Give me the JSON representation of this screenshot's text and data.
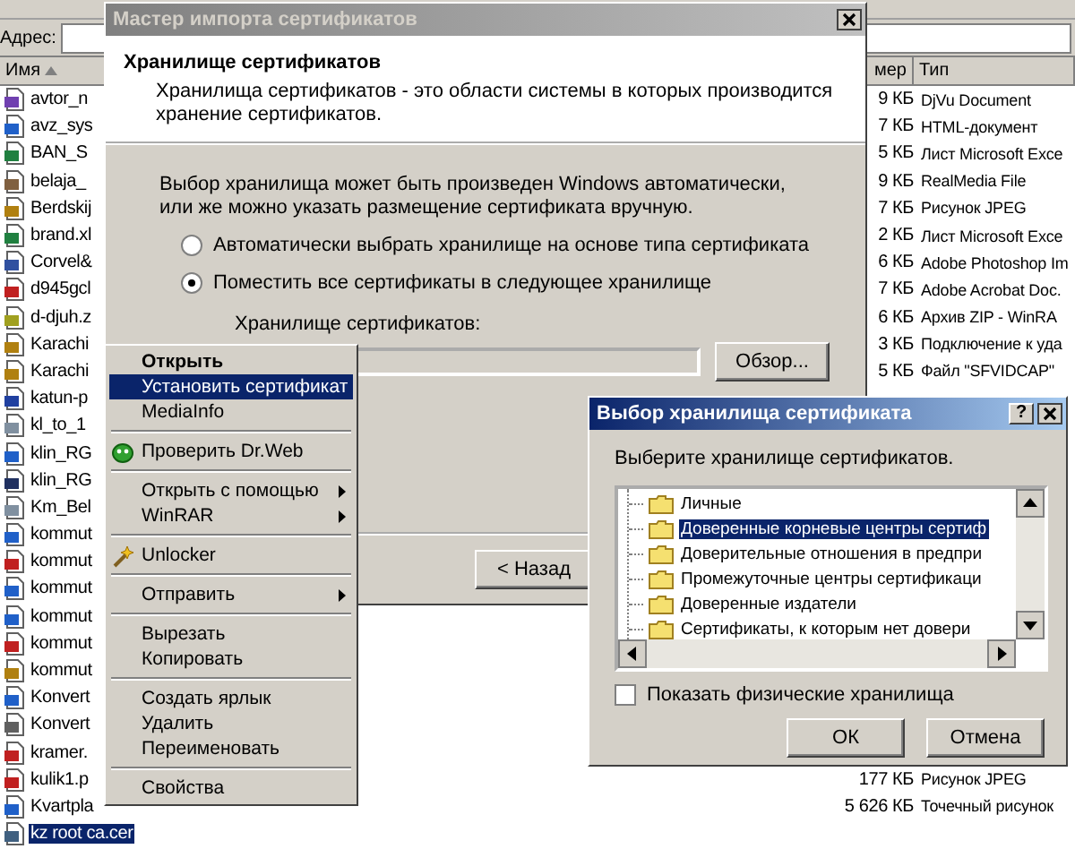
{
  "explorer": {
    "address_label": "Адрес:",
    "columns": [
      {
        "label": "Имя",
        "sorted": true
      },
      {
        "label": "мер",
        "sorted": false
      },
      {
        "label": "Тип",
        "sorted": false
      }
    ],
    "files": [
      {
        "name": "avtor_n",
        "kind": "djvu",
        "size": "9 КБ",
        "type": "DjVu Document",
        "selected": false
      },
      {
        "name": "avz_sys",
        "kind": "web",
        "size": "7 КБ",
        "type": "HTML-документ",
        "selected": false
      },
      {
        "name": "BAN_S",
        "kind": "excel",
        "size": "5 КБ",
        "type": "Лист Microsoft Exce",
        "selected": false
      },
      {
        "name": "belaja_",
        "kind": "media",
        "size": "9 КБ",
        "type": "RealMedia File",
        "selected": false
      },
      {
        "name": "Berdskij",
        "kind": "image",
        "size": "7 КБ",
        "type": "Рисунок JPEG",
        "selected": false
      },
      {
        "name": "brand.xl",
        "kind": "excel",
        "size": "2 КБ",
        "type": "Лист Microsoft Exce",
        "selected": false
      },
      {
        "name": "Corvel&",
        "kind": "psd",
        "size": "6 КБ",
        "type": "Adobe Photoshop Im",
        "selected": false
      },
      {
        "name": "d945gcl",
        "kind": "pdf",
        "size": "7 КБ",
        "type": "Adobe Acrobat Doc.",
        "selected": false
      },
      {
        "name": "d-djuh.z",
        "kind": "zip",
        "size": "6 КБ",
        "type": "Архив ZIP - WinRA",
        "selected": false
      },
      {
        "name": "Karachi",
        "kind": "image",
        "size": "3 КБ",
        "type": "Подключение к уда",
        "selected": false
      },
      {
        "name": "Karachi",
        "kind": "image",
        "size": "5 КБ",
        "type": "Файл \"SFVIDCAP\"",
        "selected": false
      },
      {
        "name": "katun-p",
        "kind": "bmp",
        "selected": false
      },
      {
        "name": "kl_to_1",
        "kind": "doc",
        "selected": false
      },
      {
        "name": "klin_RG",
        "kind": "web",
        "selected": false
      },
      {
        "name": "klin_RG",
        "kind": "tif",
        "selected": false
      },
      {
        "name": "Km_Bel",
        "kind": "doc",
        "selected": false
      },
      {
        "name": "kommut",
        "kind": "web",
        "selected": false
      },
      {
        "name": "kommut",
        "kind": "pdf",
        "selected": false
      },
      {
        "name": "kommut",
        "kind": "web",
        "selected": false
      },
      {
        "name": "kommut",
        "kind": "web",
        "selected": false
      },
      {
        "name": "kommut",
        "kind": "pdf",
        "selected": false
      },
      {
        "name": "kommut",
        "kind": "image",
        "selected": false
      },
      {
        "name": "Konvert",
        "kind": "web",
        "selected": false
      },
      {
        "name": "Konvert",
        "kind": "exe",
        "selected": false
      },
      {
        "name": "kramer.",
        "kind": "pdf",
        "selected": false
      },
      {
        "name": "kulik1.p",
        "kind": "pdf",
        "size": "177 КБ",
        "type": "Рисунок JPEG",
        "selected": false
      },
      {
        "name": "Kvartpla",
        "kind": "web",
        "size": "5 626 КБ",
        "type": "Точечный рисунок",
        "selected": false
      },
      {
        "name": "kz root ca.cer",
        "kind": "cert",
        "selected": true
      }
    ]
  },
  "wizard": {
    "title": "Мастер импорта сертификатов",
    "heading": "Хранилище сертификатов",
    "description": "Хранилища сертификатов - это области системы в которых производится хранение сертификатов.",
    "intro": "Выбор хранилища может быть произведен Windows автоматически, или же можно указать размещение сертификата вручную.",
    "options": [
      {
        "label": "Автоматически выбрать хранилище на основе типа сертификата",
        "selected": false
      },
      {
        "label": "Поместить все сертификаты в следующее хранилище",
        "selected": true
      }
    ],
    "store_label": "Хранилище сертификатов:",
    "browse_button": "Обзор...",
    "back_button": "< Назад"
  },
  "context_menu": {
    "groups": [
      [
        {
          "label": "Открыть",
          "default": true,
          "selected": false,
          "submenu": false
        },
        {
          "label": "Установить сертификат",
          "default": false,
          "selected": true,
          "submenu": false
        },
        {
          "label": "MediaInfo",
          "default": false,
          "selected": false,
          "submenu": false
        }
      ],
      [
        {
          "label": "Проверить Dr.Web",
          "kind": "antivirus",
          "default": false,
          "selected": false,
          "submenu": false
        }
      ],
      [
        {
          "label": "Открыть с помощью",
          "default": false,
          "selected": false,
          "submenu": true
        },
        {
          "label": "WinRAR",
          "default": false,
          "selected": false,
          "submenu": true
        }
      ],
      [
        {
          "label": "Unlocker",
          "kind": "tool",
          "default": false,
          "selected": false,
          "submenu": false
        }
      ],
      [
        {
          "label": "Отправить",
          "default": false,
          "selected": false,
          "submenu": true
        }
      ],
      [
        {
          "label": "Вырезать",
          "default": false,
          "selected": false,
          "submenu": false
        },
        {
          "label": "Копировать",
          "default": false,
          "selected": false,
          "submenu": false
        }
      ],
      [
        {
          "label": "Создать ярлык",
          "default": false,
          "selected": false,
          "submenu": false
        },
        {
          "label": "Удалить",
          "default": false,
          "selected": false,
          "submenu": false
        },
        {
          "label": "Переименовать",
          "default": false,
          "selected": false,
          "submenu": false
        }
      ],
      [
        {
          "label": "Свойства",
          "default": false,
          "selected": false,
          "submenu": false
        }
      ]
    ]
  },
  "store_dialog": {
    "title": "Выбор хранилища сертификата",
    "help_button": "?",
    "prompt": "Выберите хранилище сертификатов.",
    "stores": [
      {
        "label": "Личные",
        "selected": false
      },
      {
        "label": "Доверенные корневые центры сертиф",
        "selected": true
      },
      {
        "label": "Доверительные отношения в предпри",
        "selected": false
      },
      {
        "label": "Промежуточные центры сертификаци",
        "selected": false
      },
      {
        "label": "Доверенные издатели",
        "selected": false
      },
      {
        "label": "Сертификаты, к которым нет довери",
        "selected": false
      }
    ],
    "show_physical": {
      "label": "Показать физические хранилища",
      "checked": false
    },
    "ok_button": "ОК",
    "cancel_button": "Отмена"
  }
}
